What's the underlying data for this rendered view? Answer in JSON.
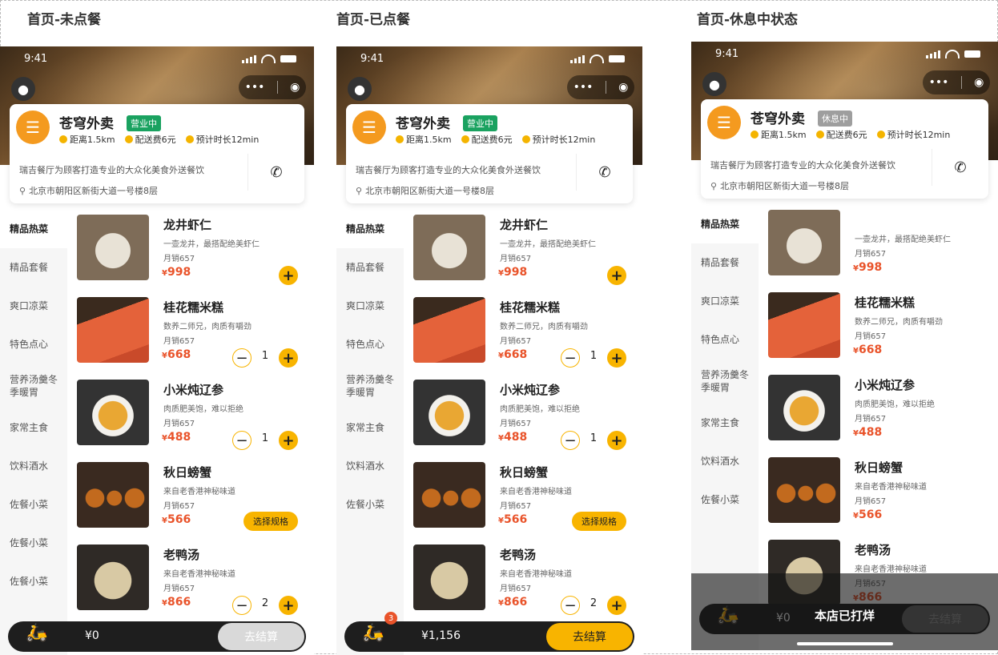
{
  "panels": [
    {
      "title": "首页-未点餐",
      "time": "9:41",
      "shop_name": "苍穹外卖",
      "status": "营业中",
      "status_color": "#1aa260",
      "info": [
        "距离1.5km",
        "配送费6元",
        "预计时长12min"
      ],
      "desc": "瑞吉餐厅为顾客打造专业的大众化美食外送餐饮",
      "addr": "北京市朝阳区新街大道一号楼8层",
      "categories": [
        "精品热菜",
        "精品套餐",
        "爽口凉菜",
        "特色点心",
        "营养汤羹冬季暖胃",
        "家常主食",
        "饮料酒水",
        "佐餐小菜",
        "佐餐小菜",
        "佐餐小菜"
      ],
      "items": [
        {
          "name": "龙井虾仁",
          "desc": "一壶龙井，最搭配绝美虾仁",
          "sales": "月销657",
          "price": "998",
          "control": "plus"
        },
        {
          "name": "桂花糯米糕",
          "desc": "数养二师兄，肉质有嚼劲",
          "sales": "月销657",
          "price": "668",
          "control": "stepper",
          "qty": "1"
        },
        {
          "name": "小米炖辽参",
          "desc": "肉质肥美饱，难以拒绝",
          "sales": "月销657",
          "price": "488",
          "control": "stepper",
          "qty": "1"
        },
        {
          "name": "秋日螃蟹",
          "desc": "来自老香港神秘味道",
          "sales": "月销657",
          "price": "566",
          "control": "spec",
          "spec": "选择规格"
        },
        {
          "name": "老鸭汤",
          "desc": "来自老香港神秘味道",
          "sales": "月销657",
          "price": "866",
          "control": "stepper",
          "qty": "2"
        }
      ],
      "cart_total": "¥0",
      "checkout": "去结算",
      "checkout_bg": "#d9d9d9",
      "checkout_color": "#ffffff"
    },
    {
      "title": "首页-已点餐",
      "time": "9:41",
      "shop_name": "苍穹外卖",
      "status": "营业中",
      "status_color": "#1aa260",
      "info": [
        "距离1.5km",
        "配送费6元",
        "预计时长12min"
      ],
      "desc": "瑞吉餐厅为顾客打造专业的大众化美食外送餐饮",
      "addr": "北京市朝阳区新街大道一号楼8层",
      "categories": [
        "精品热菜",
        "精品套餐",
        "爽口凉菜",
        "特色点心",
        "营养汤羹冬季暖胃",
        "家常主食",
        "饮料酒水",
        "佐餐小菜"
      ],
      "items": [
        {
          "name": "龙井虾仁",
          "desc": "一壶龙井，最搭配绝美虾仁",
          "sales": "月销657",
          "price": "998",
          "control": "plus"
        },
        {
          "name": "桂花糯米糕",
          "desc": "数养二师兄，肉质有嚼劲",
          "sales": "月销657",
          "price": "668",
          "control": "stepper",
          "qty": "1"
        },
        {
          "name": "小米炖辽参",
          "desc": "肉质肥美饱，难以拒绝",
          "sales": "月销657",
          "price": "488",
          "control": "stepper",
          "qty": "1"
        },
        {
          "name": "秋日螃蟹",
          "desc": "来自老香港神秘味道",
          "sales": "月销657",
          "price": "566",
          "control": "spec",
          "spec": "选择规格"
        },
        {
          "name": "老鸭汤",
          "desc": "来自老香港神秘味道",
          "sales": "月销657",
          "price": "866",
          "control": "stepper",
          "qty": "2"
        }
      ],
      "cart_total": "¥1,156",
      "cart_count": "3",
      "checkout": "去结算",
      "checkout_bg": "#f8b400",
      "checkout_color": "#222222"
    },
    {
      "title": "首页-休息中状态",
      "time": "9:41",
      "shop_name": "苍穹外卖",
      "status": "休息中",
      "status_color": "#9e9e9e",
      "info": [
        "距离1.5km",
        "配送费6元",
        "预计时长12min"
      ],
      "desc": "瑞吉餐厅为顾客打造专业的大众化美食外送餐饮",
      "addr": "北京市朝阳区新街大道一号楼8层",
      "categories": [
        "精品热菜",
        "精品套餐",
        "爽口凉菜",
        "特色点心",
        "营养汤羹冬季暖胃",
        "家常主食",
        "饮料酒水",
        "佐餐小菜"
      ],
      "items": [
        {
          "name": "",
          "desc": "一壶龙井，最搭配绝美虾仁",
          "sales": "月销657",
          "price": "998",
          "control": "none"
        },
        {
          "name": "桂花糯米糕",
          "desc": "数养二师兄，肉质有嚼劲",
          "sales": "月销657",
          "price": "668",
          "control": "none"
        },
        {
          "name": "小米炖辽参",
          "desc": "肉质肥美饱，难以拒绝",
          "sales": "月销657",
          "price": "488",
          "control": "none"
        },
        {
          "name": "秋日螃蟹",
          "desc": "来自老香港神秘味道",
          "sales": "月销657",
          "price": "566",
          "control": "none"
        },
        {
          "name": "老鸭汤",
          "desc": "来自老香港神秘味道",
          "sales": "月销657",
          "price": "866",
          "control": "none"
        }
      ],
      "cart_total": "¥0",
      "checkout": "去结算",
      "checkout_bg": "#6b6b6b",
      "checkout_color": "#999999",
      "closed_msg": "本店已打烊"
    }
  ]
}
